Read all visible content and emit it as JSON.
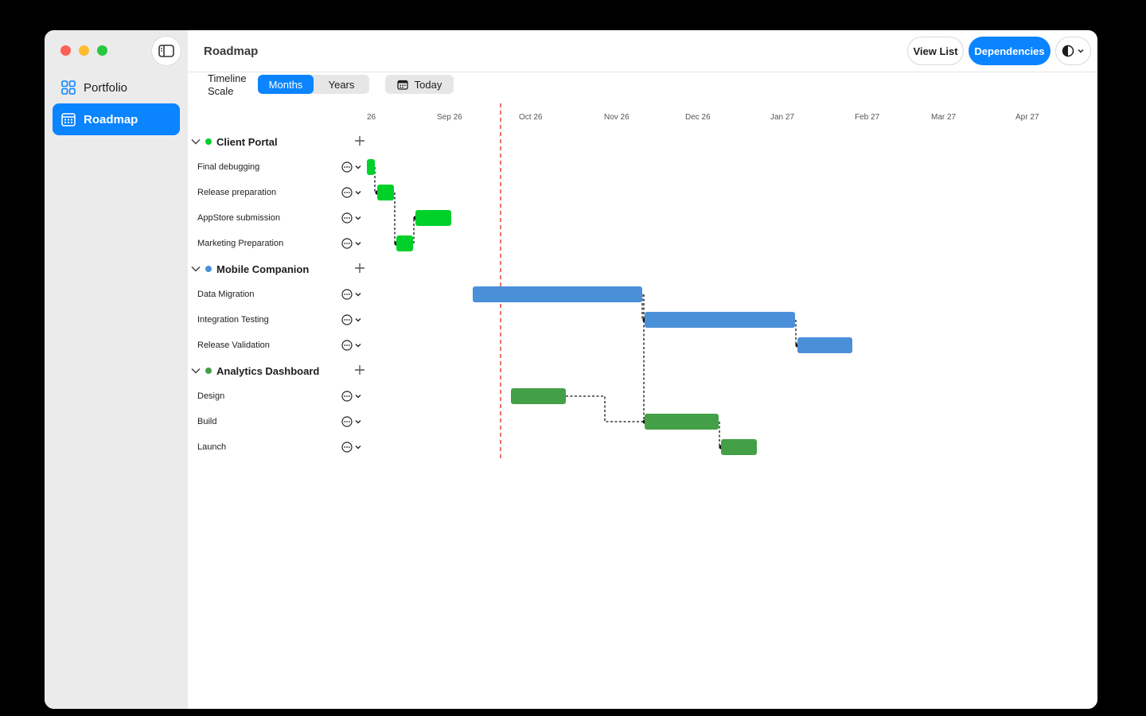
{
  "sidebar": {
    "items": [
      {
        "label": "Portfolio",
        "icon": "grid-icon",
        "active": false
      },
      {
        "label": "Roadmap",
        "icon": "calendar-icon",
        "active": true
      }
    ]
  },
  "toolbar": {
    "title": "Roadmap",
    "view_list_label": "View List",
    "dependencies_label": "Dependencies",
    "theme_icon": "half-circle-icon"
  },
  "controls": {
    "scale_label": "Timeline Scale",
    "scale_options": [
      "Months",
      "Years"
    ],
    "scale_selected": "Months",
    "today_label": "Today"
  },
  "timeline": {
    "months": [
      "26",
      "Sep 26",
      "Oct 26",
      "Nov 26",
      "Dec 26",
      "Jan 27",
      "Feb 27",
      "Mar 27",
      "Apr 27"
    ],
    "today_color": "#e8453c"
  },
  "groups": [
    {
      "name": "Client Portal",
      "color": "#00d12a",
      "tasks": [
        {
          "name": "Final debugging"
        },
        {
          "name": "Release preparation"
        },
        {
          "name": "AppStore submission"
        },
        {
          "name": "Marketing Preparation"
        }
      ]
    },
    {
      "name": "Mobile Companion",
      "color": "#4a90d9",
      "tasks": [
        {
          "name": "Data Migration"
        },
        {
          "name": "Integration Testing"
        },
        {
          "name": "Release Validation"
        }
      ]
    },
    {
      "name": "Analytics Dashboard",
      "color": "#43a047",
      "tasks": [
        {
          "name": "Design"
        },
        {
          "name": "Build"
        },
        {
          "name": "Launch"
        }
      ]
    }
  ]
}
